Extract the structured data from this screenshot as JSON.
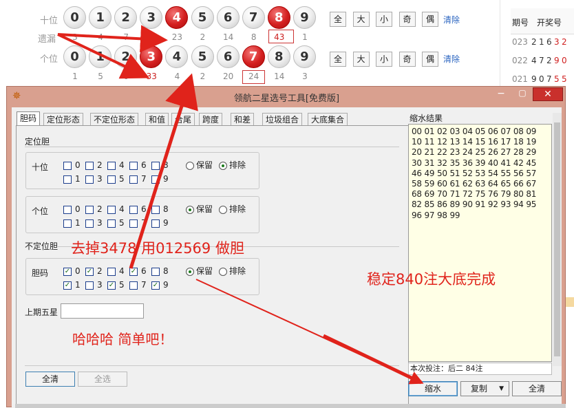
{
  "top": {
    "tens_label": "十位",
    "missing_label": "遗漏",
    "units_label": "个位",
    "balls": [
      "0",
      "1",
      "2",
      "3",
      "4",
      "5",
      "6",
      "7",
      "8",
      "9"
    ],
    "tens_missing": [
      "3",
      "4",
      "7",
      "3",
      "23",
      "2",
      "14",
      "8",
      "43",
      "1"
    ],
    "units_missing": [
      "1",
      "5",
      "0",
      "33",
      "4",
      "2",
      "20",
      "24",
      "14",
      "3"
    ],
    "select_buttons": [
      "全",
      "大",
      "小",
      "奇",
      "偶"
    ],
    "clear_label": "清除"
  },
  "history": {
    "col_issue": "期号",
    "col_draw": "开奖号",
    "rows": [
      {
        "issue": "023",
        "digits": [
          "2",
          "1",
          "6",
          "3",
          "2"
        ]
      },
      {
        "issue": "022",
        "digits": [
          "4",
          "7",
          "2",
          "9",
          "0"
        ]
      },
      {
        "issue": "021",
        "digits": [
          "9",
          "0",
          "7",
          "5",
          "5"
        ]
      }
    ]
  },
  "window": {
    "title": "领航二星选号工具[免费版]",
    "tabs": [
      "胆码",
      "定位形态",
      "不定位形态",
      "和值",
      "合尾",
      "跨度",
      "和差",
      "垃圾组合",
      "大底集合"
    ],
    "section_fixed": "定位胆",
    "tens_label": "十位",
    "units_label": "个位",
    "keep_label": "保留",
    "exclude_label": "排除",
    "section_unfixed": "不定位胆",
    "dan_label": "胆码",
    "last5_label": "上期五星",
    "last5_value": "",
    "clear_all": "全清",
    "select_all": "全选",
    "result_title": "缩水结果",
    "result_lines": [
      "00 01 02 03 04 05 06 07 08 09",
      "10 11 12 13 14 15 16 17 18 19",
      "20 21 22 23 24 25 26 27 28 29",
      "30 31 32 35 36 39 40 41 42 45",
      "46 49 50 51 52 53 54 55 56 57",
      "58 59 60 61 62 63 64 65 66 67",
      "68 69 70 71 72 75 76 79 80 81",
      "82 85 86 89 90 91 92 93 94 95",
      "96 97 98 99"
    ],
    "status": "本次投注：后二 84注",
    "btn_shrink": "缩水",
    "btn_copy": "复制",
    "btn_clear": "全清"
  },
  "annotations": {
    "a1": "去掉3478 用012569 做胆",
    "a2": "稳定840注大底完成",
    "a3": "哈哈哈 简单吧！"
  }
}
